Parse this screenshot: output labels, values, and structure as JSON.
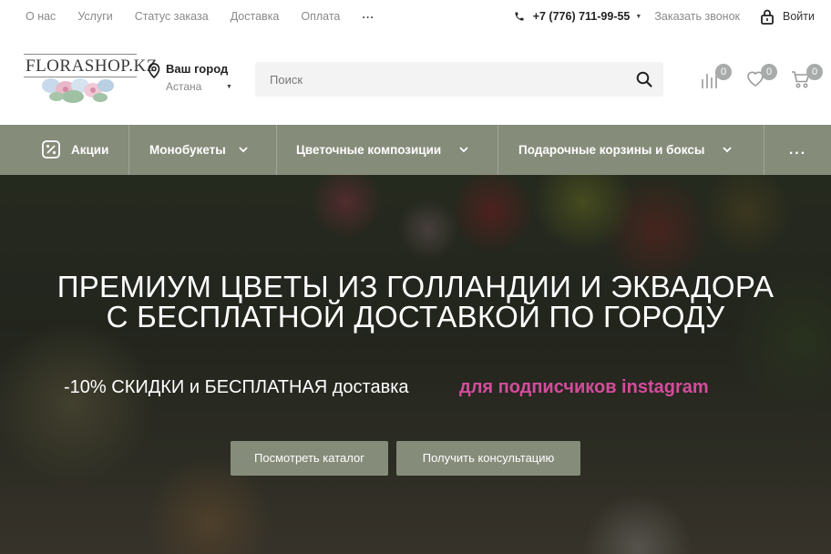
{
  "topbar": {
    "links": [
      "О нас",
      "Услуги",
      "Статус заказа",
      "Доставка",
      "Оплата"
    ],
    "more": "...",
    "phone": "+7 (776) 711-99-55",
    "callback": "Заказать звонок",
    "login": "Войти"
  },
  "header": {
    "logo_text": "FLORASHOP.KZ",
    "city_label": "Ваш город",
    "city_name": "Астана",
    "search_placeholder": "Поиск",
    "compare_count": "0",
    "favorites_count": "0",
    "cart_count": "0"
  },
  "nav": {
    "items": [
      "Акции",
      "Монобукеты",
      "Цветочные композиции",
      "Подарочные корзины и боксы"
    ],
    "more": "..."
  },
  "hero": {
    "title_line1": "ПРЕМИУМ ЦВЕТЫ ИЗ ГОЛЛАНДИИ И ЭКВАДОРА",
    "title_line2": "С БЕСПЛАТНОЙ ДОСТАВКОЙ ПО ГОРОДУ",
    "promo_text": "-10% СКИДКИ и БЕСПЛАТНАЯ доставка",
    "promo_highlight": "для подписчиков instagram",
    "btn_catalog": "Посмотреть каталог",
    "btn_consult": "Получить консультацию"
  },
  "colors": {
    "accent": "#868c7a",
    "highlight": "#d44c9c",
    "badge": "#a9aaaa"
  }
}
